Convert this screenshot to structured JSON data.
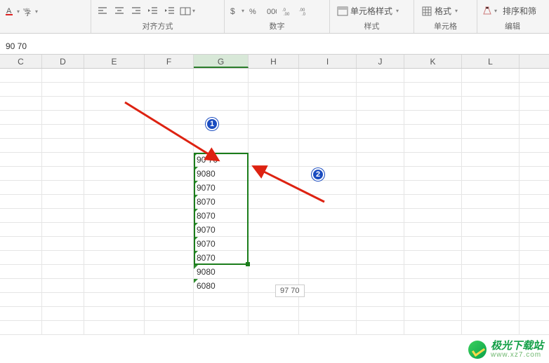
{
  "ribbon": {
    "groups": {
      "font": {
        "label": ""
      },
      "align": {
        "label": "对齐方式"
      },
      "number": {
        "label": "数字"
      },
      "styles": {
        "label": "样式",
        "cell_styles": "单元格样式"
      },
      "cells": {
        "label": "单元格",
        "format": "格式"
      },
      "editing": {
        "label": "编辑",
        "sort": "排序和筛"
      }
    }
  },
  "formula_bar": {
    "value": "90 70"
  },
  "columns": [
    "C",
    "D",
    "E",
    "F",
    "G",
    "H",
    "I",
    "J",
    "K",
    "L"
  ],
  "data_g": [
    "90 70",
    "9080",
    "9070",
    "8070",
    "8070",
    "9070",
    "9070",
    "8070",
    "9080",
    "6080"
  ],
  "tooltip": "97 70",
  "badges": {
    "one": "1",
    "two": "2"
  },
  "watermark": {
    "name": "极光下载站",
    "sub": "www.xz7.com"
  },
  "chart_data": null
}
